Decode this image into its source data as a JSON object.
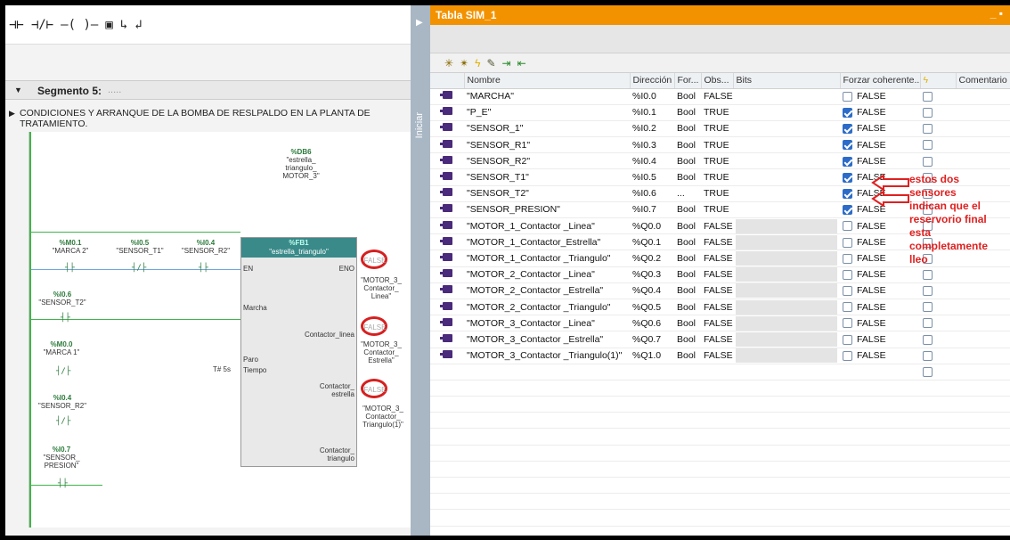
{
  "lad": {
    "toolbar_icons": [
      "normally-open-contact-icon",
      "normally-closed-contact-icon",
      "coil-icon",
      "empty-box-icon",
      "open-branch-icon",
      "close-branch-icon"
    ],
    "segment_title": "Segmento 5:",
    "segment_dots": ".....",
    "segment_comment": "CONDICIONES Y ARRANQUE DE LA BOMBA DE RESLPALDO EN LA PLANTA DE TRATAMIENTO.",
    "db_addr": "%DB6",
    "db_name_1": "\"estrella_",
    "db_name_2": "triangulo_",
    "db_name_3": "MOTOR_3\"",
    "fb_addr": "%FB1",
    "fb_name": "\"estrella_triangulo\"",
    "pin_en": "EN",
    "pin_eno": "ENO",
    "pin_marcha": "Marcha",
    "pin_paro": "Paro",
    "pin_tiempo": "Tiempo",
    "pin_contactor_linea": "Contactor_linea",
    "pin_contactor_estrella_1": "Contactor_",
    "pin_contactor_estrella_2": "estrella",
    "pin_contactor_triangulo_1": "Contactor_",
    "pin_contactor_triangulo_2": "triangulo",
    "tiempo_val": "T# 5s",
    "contacts": [
      {
        "addr": "%M0.1",
        "name": "\"MARCA 2\""
      },
      {
        "addr": "%I0.5",
        "name": "\"SENSOR_T1\""
      },
      {
        "addr": "%I0.4",
        "name": "\"SENSOR_R2\""
      },
      {
        "addr": "%I0.6",
        "name": "\"SENSOR_T2\""
      },
      {
        "addr": "%M0.0",
        "name": "\"MARCA 1\""
      },
      {
        "addr": "%I0.4",
        "name": "\"SENSOR_R2\""
      },
      {
        "addr": "%I0.7",
        "name": "\"SENSOR_\nPRESION\""
      }
    ],
    "out_linea": "\"MOTOR_3_\nContactor_\nLinea\"",
    "out_estrella": "\"MOTOR_3_\nContactor_\nEstrella\"",
    "out_triangulo": "\"MOTOR_3_\nContactor_\nTriangulo(1)\"",
    "false_label": "FALSE"
  },
  "strip": {
    "label": "Iniciar"
  },
  "sim": {
    "title": "Tabla SIM_1",
    "toolbar_icons": [
      "add-row-icon",
      "insert-row-icon",
      "lightning-icon",
      "modify-icon",
      "export-icon",
      "import-icon"
    ],
    "columns": [
      "Nombre",
      "Dirección",
      "For...",
      "Obs...",
      "Bits",
      "Forzar coherente...",
      "",
      "Comentario"
    ],
    "rows": [
      {
        "name": "\"MARCHA\"",
        "addr": "%I0.0",
        "fmt": "Bool",
        "obs": "FALSE",
        "bits": false,
        "force": "FALSE",
        "force_cb": false
      },
      {
        "name": "\"P_E\"",
        "addr": "%I0.1",
        "fmt": "Bool",
        "obs": "TRUE",
        "bits": false,
        "force": "FALSE",
        "force_cb": true
      },
      {
        "name": "\"SENSOR_1\"",
        "addr": "%I0.2",
        "fmt": "Bool",
        "obs": "TRUE",
        "bits": false,
        "force": "FALSE",
        "force_cb": true
      },
      {
        "name": "\"SENSOR_R1\"",
        "addr": "%I0.3",
        "fmt": "Bool",
        "obs": "TRUE",
        "bits": false,
        "force": "FALSE",
        "force_cb": true
      },
      {
        "name": "\"SENSOR_R2\"",
        "addr": "%I0.4",
        "fmt": "Bool",
        "obs": "TRUE",
        "bits": false,
        "force": "FALSE",
        "force_cb": true
      },
      {
        "name": "\"SENSOR_T1\"",
        "addr": "%I0.5",
        "fmt": "Bool",
        "obs": "TRUE",
        "bits": false,
        "force": "FALSE",
        "force_cb": true
      },
      {
        "name": "\"SENSOR_T2\"",
        "addr": "%I0.6",
        "fmt": "...",
        "obs": "TRUE",
        "bits": false,
        "force": "FALSE",
        "force_cb": true
      },
      {
        "name": "\"SENSOR_PRESION\"",
        "addr": "%I0.7",
        "fmt": "Bool",
        "obs": "TRUE",
        "bits": false,
        "force": "FALSE",
        "force_cb": true
      },
      {
        "name": "\"MOTOR_1_Contactor _Linea\"",
        "addr": "%Q0.0",
        "fmt": "Bool",
        "obs": "FALSE",
        "bits": true,
        "force": "FALSE",
        "force_cb": false
      },
      {
        "name": "\"MOTOR_1_Contactor_Estrella\"",
        "addr": "%Q0.1",
        "fmt": "Bool",
        "obs": "FALSE",
        "bits": true,
        "force": "FALSE",
        "force_cb": false
      },
      {
        "name": "\"MOTOR_1_Contactor _Triangulo\"",
        "addr": "%Q0.2",
        "fmt": "Bool",
        "obs": "FALSE",
        "bits": true,
        "force": "FALSE",
        "force_cb": false
      },
      {
        "name": "\"MOTOR_2_Contactor _Linea\"",
        "addr": "%Q0.3",
        "fmt": "Bool",
        "obs": "FALSE",
        "bits": true,
        "force": "FALSE",
        "force_cb": false
      },
      {
        "name": "\"MOTOR_2_Contactor _Estrella\"",
        "addr": "%Q0.4",
        "fmt": "Bool",
        "obs": "FALSE",
        "bits": true,
        "force": "FALSE",
        "force_cb": false
      },
      {
        "name": "\"MOTOR_2_Contactor _Triangulo\"",
        "addr": "%Q0.5",
        "fmt": "Bool",
        "obs": "FALSE",
        "bits": true,
        "force": "FALSE",
        "force_cb": false
      },
      {
        "name": "\"MOTOR_3_Contactor _Linea\"",
        "addr": "%Q0.6",
        "fmt": "Bool",
        "obs": "FALSE",
        "bits": true,
        "force": "FALSE",
        "force_cb": false
      },
      {
        "name": "\"MOTOR_3_Contactor _Estrella\"",
        "addr": "%Q0.7",
        "fmt": "Bool",
        "obs": "FALSE",
        "bits": true,
        "force": "FALSE",
        "force_cb": false
      },
      {
        "name": "\"MOTOR_3_Contactor _Triangulo(1)\"",
        "addr": "%Q1.0",
        "fmt": "Bool",
        "obs": "FALSE",
        "bits": true,
        "force": "FALSE",
        "force_cb": false
      }
    ]
  },
  "annotation": {
    "text_1": "estos dos",
    "text_2": "sensores",
    "text_3": "indican que el",
    "text_4": "reservorio final",
    "text_5": "esta",
    "text_6": "completamente",
    "text_7": "lleo",
    "color": "#e02020"
  }
}
